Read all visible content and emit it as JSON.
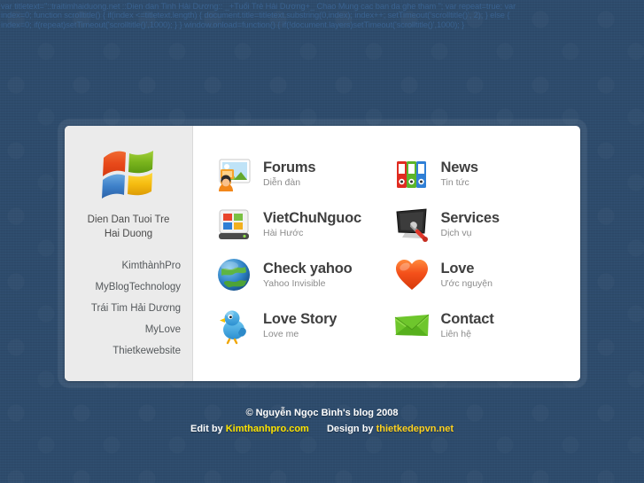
{
  "top_code": {
    "line1": "var titletext=\"::traitimhaiduong.net ::Dien dan Tinh Hải Dương::  _+Tuổi Trẻ Hải Dương+_ Chao Mung cac ban da ghe tham \"; var repeat=true; var",
    "line2": "index=0; function scrolltitle() { if(index <=titletext.length) { document.title=titletext.substring(0,index); index++; setTimeout('scrolltitle()', 2); } else {",
    "line3": "index=0; if(repeat)setTimeout('scrolltitle()',1000); } } window.onload=function() { if(!document.layers)setTimeout('scrolltitle()',1000); }"
  },
  "sidebar": {
    "logo_icon": "windows-logo-icon",
    "title_line1": "Dien Dan Tuoi Tre",
    "title_line2": "Hai Duong",
    "links": [
      {
        "label": "KimthànhPro"
      },
      {
        "label": "MyBlogTechnology"
      },
      {
        "label": "Trái Tim Hải Dương"
      },
      {
        "label": "MyLove"
      },
      {
        "label": "Thietkewebsite"
      }
    ]
  },
  "main": {
    "items": [
      {
        "title": "Forums",
        "sub": "Diễn đàn",
        "icon": "forums-photos-icon"
      },
      {
        "title": "News",
        "sub": "Tin tức",
        "icon": "news-binders-icon"
      },
      {
        "title": "VietChuNguoc",
        "sub": "Hài Hước",
        "icon": "vietchunguoc-drive-icon"
      },
      {
        "title": "Services",
        "sub": "Dịch vụ",
        "icon": "services-monitor-tools-icon"
      },
      {
        "title": "Check yahoo",
        "sub": "Yahoo Invisible",
        "icon": "check-yahoo-globe-icon"
      },
      {
        "title": "Love",
        "sub": "Ước nguyện",
        "icon": "love-heart-icon"
      },
      {
        "title": "Love Story",
        "sub": "Love me",
        "icon": "love-story-bird-icon"
      },
      {
        "title": "Contact",
        "sub": "Liên hệ",
        "icon": "contact-envelope-icon"
      }
    ]
  },
  "footer": {
    "copyright": "© Nguyễn Ngọc Bình's blog 2008",
    "edit_by_label": "Edit by",
    "edit_by_link": "Kimthanhpro.com",
    "design_by_label": "Design by",
    "design_by_link": "thietkedepvn.net"
  },
  "colors": {
    "background": "#2e4c6d",
    "card": "#ffffff",
    "sidebar": "#ebebeb",
    "link_yellow": "#ffe400",
    "link_gold": "#ffd21e",
    "title_text": "#3f3f3f",
    "sub_text": "#8b8b8b"
  }
}
